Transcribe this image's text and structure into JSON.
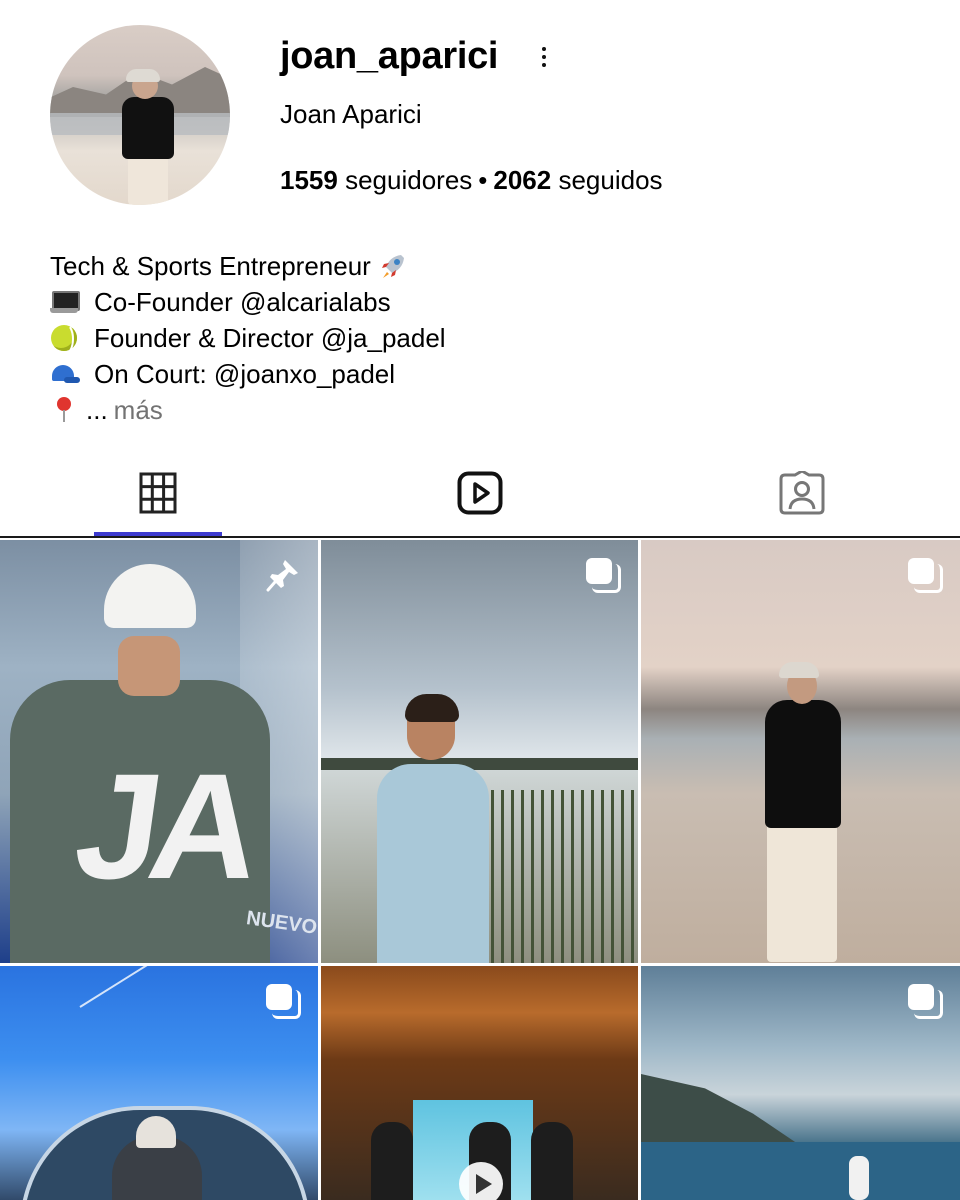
{
  "profile": {
    "username": "joan_aparici",
    "full_name": "Joan Aparici",
    "followers_count": "1559",
    "followers_label": "seguidores",
    "separator": "•",
    "following_count": "2062",
    "following_label": "seguidos"
  },
  "bio": {
    "line1": "Tech & Sports Entrepreneur",
    "line2": "Co-Founder @alcarialabs",
    "line3": "Founder & Director @ja_padel",
    "line4": "On Court: @joanxo_padel",
    "line5": "...",
    "more": "más",
    "icons": [
      "rocket-icon",
      "laptop-icon",
      "tennis-ball-icon",
      "cap-icon",
      "pin-icon"
    ]
  },
  "tabs": [
    {
      "id": "posts",
      "icon": "grid-icon",
      "active": true
    },
    {
      "id": "reels",
      "icon": "reels-icon",
      "active": false
    },
    {
      "id": "tagged",
      "icon": "tagged-icon",
      "active": false
    }
  ],
  "posts": [
    {
      "overlay": "pin-icon"
    },
    {
      "overlay": "carousel-icon"
    },
    {
      "overlay": "carousel-icon"
    },
    {
      "overlay": "carousel-icon"
    },
    {
      "overlay": "play-icon"
    },
    {
      "overlay": "carousel-icon"
    }
  ],
  "photo_texts": {
    "post1_letters": "JA",
    "post1_net": "NUEVO"
  },
  "colors": {
    "active_tab_indicator": "#3d3bd0",
    "text_primary": "#000000",
    "text_secondary": "#737373"
  }
}
